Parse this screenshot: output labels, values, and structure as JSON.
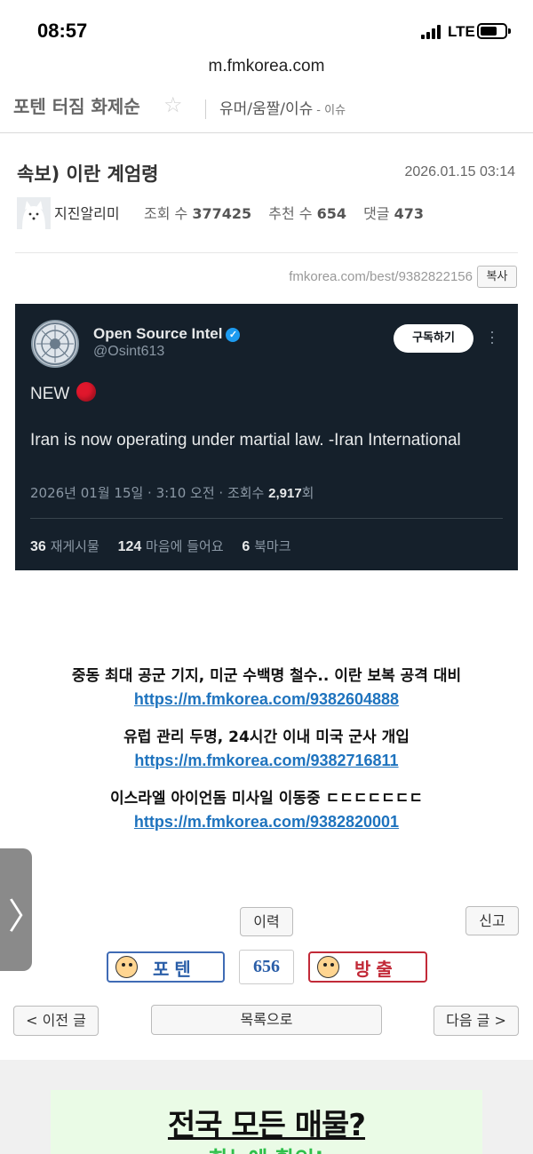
{
  "status_bar": {
    "time": "08:57",
    "network": "LTE"
  },
  "browser": {
    "url": "m.fmkorea.com"
  },
  "board": {
    "title": "포텐 터짐 화제순",
    "category": "유머/움짤/이슈",
    "subcategory": "- 이슈"
  },
  "post": {
    "title": "속보) 이란 계엄령",
    "date": "2026.01.15 03:14",
    "author": "지진알리미",
    "views_label": "조회 수",
    "views": "377425",
    "recommend_label": "추천 수",
    "recommend": "654",
    "comments_label": "댓글",
    "comments": "473",
    "permalink": "fmkorea.com/best/9382822156",
    "copy_label": "복사"
  },
  "tweet": {
    "name": "Open Source Intel",
    "handle": "@Osint613",
    "subscribe_label": "구독하기",
    "new_text": "NEW",
    "body": "Iran is now operating under martial law. -Iran International",
    "meta_prefix": "2026년 01월 15일 · 3:10 오전 · 조회수 ",
    "views": "2,917",
    "views_suffix": "회",
    "retweets": "36",
    "retweets_label": "재게시물",
    "likes": "124",
    "likes_label": "마음에 들어요",
    "bookmarks": "6",
    "bookmarks_label": "북마크"
  },
  "links": [
    {
      "headline": "중동 최대 공군 기지, 미군 수백명 철수.. 이란 보복 공격 대비",
      "url": "https://m.fmkorea.com/9382604888"
    },
    {
      "headline": "유럽 관리 두명, 24시간 이내 미국 군사 개입",
      "url": "https://m.fmkorea.com/9382716811"
    },
    {
      "headline": "이스라엘 아이언돔 미사일 이동중 ㄷㄷㄷㄷㄷㄷㄷ",
      "url": "https://m.fmkorea.com/9382820001"
    }
  ],
  "actions": {
    "history_label": "이력",
    "report_label": "신고",
    "upvote_label": "포텐",
    "vote_count": "656",
    "downvote_label": "방출",
    "prev_label": "< 이전 글",
    "list_label": "목록으로",
    "next_label": "다음 글 >"
  },
  "ad": {
    "title": "전국 모든 매물?",
    "subtitle": "한눈에 확인!"
  },
  "icons": {
    "favorite": "star-icon",
    "verified": "verified-badge-icon",
    "more": "more-vertical-icon",
    "side_handle": "chevron-right-icon"
  },
  "colors": {
    "tweet_bg": "#15202b",
    "link": "#1e73be",
    "upvote": "#2a5ea8",
    "downvote": "#c22a38"
  }
}
